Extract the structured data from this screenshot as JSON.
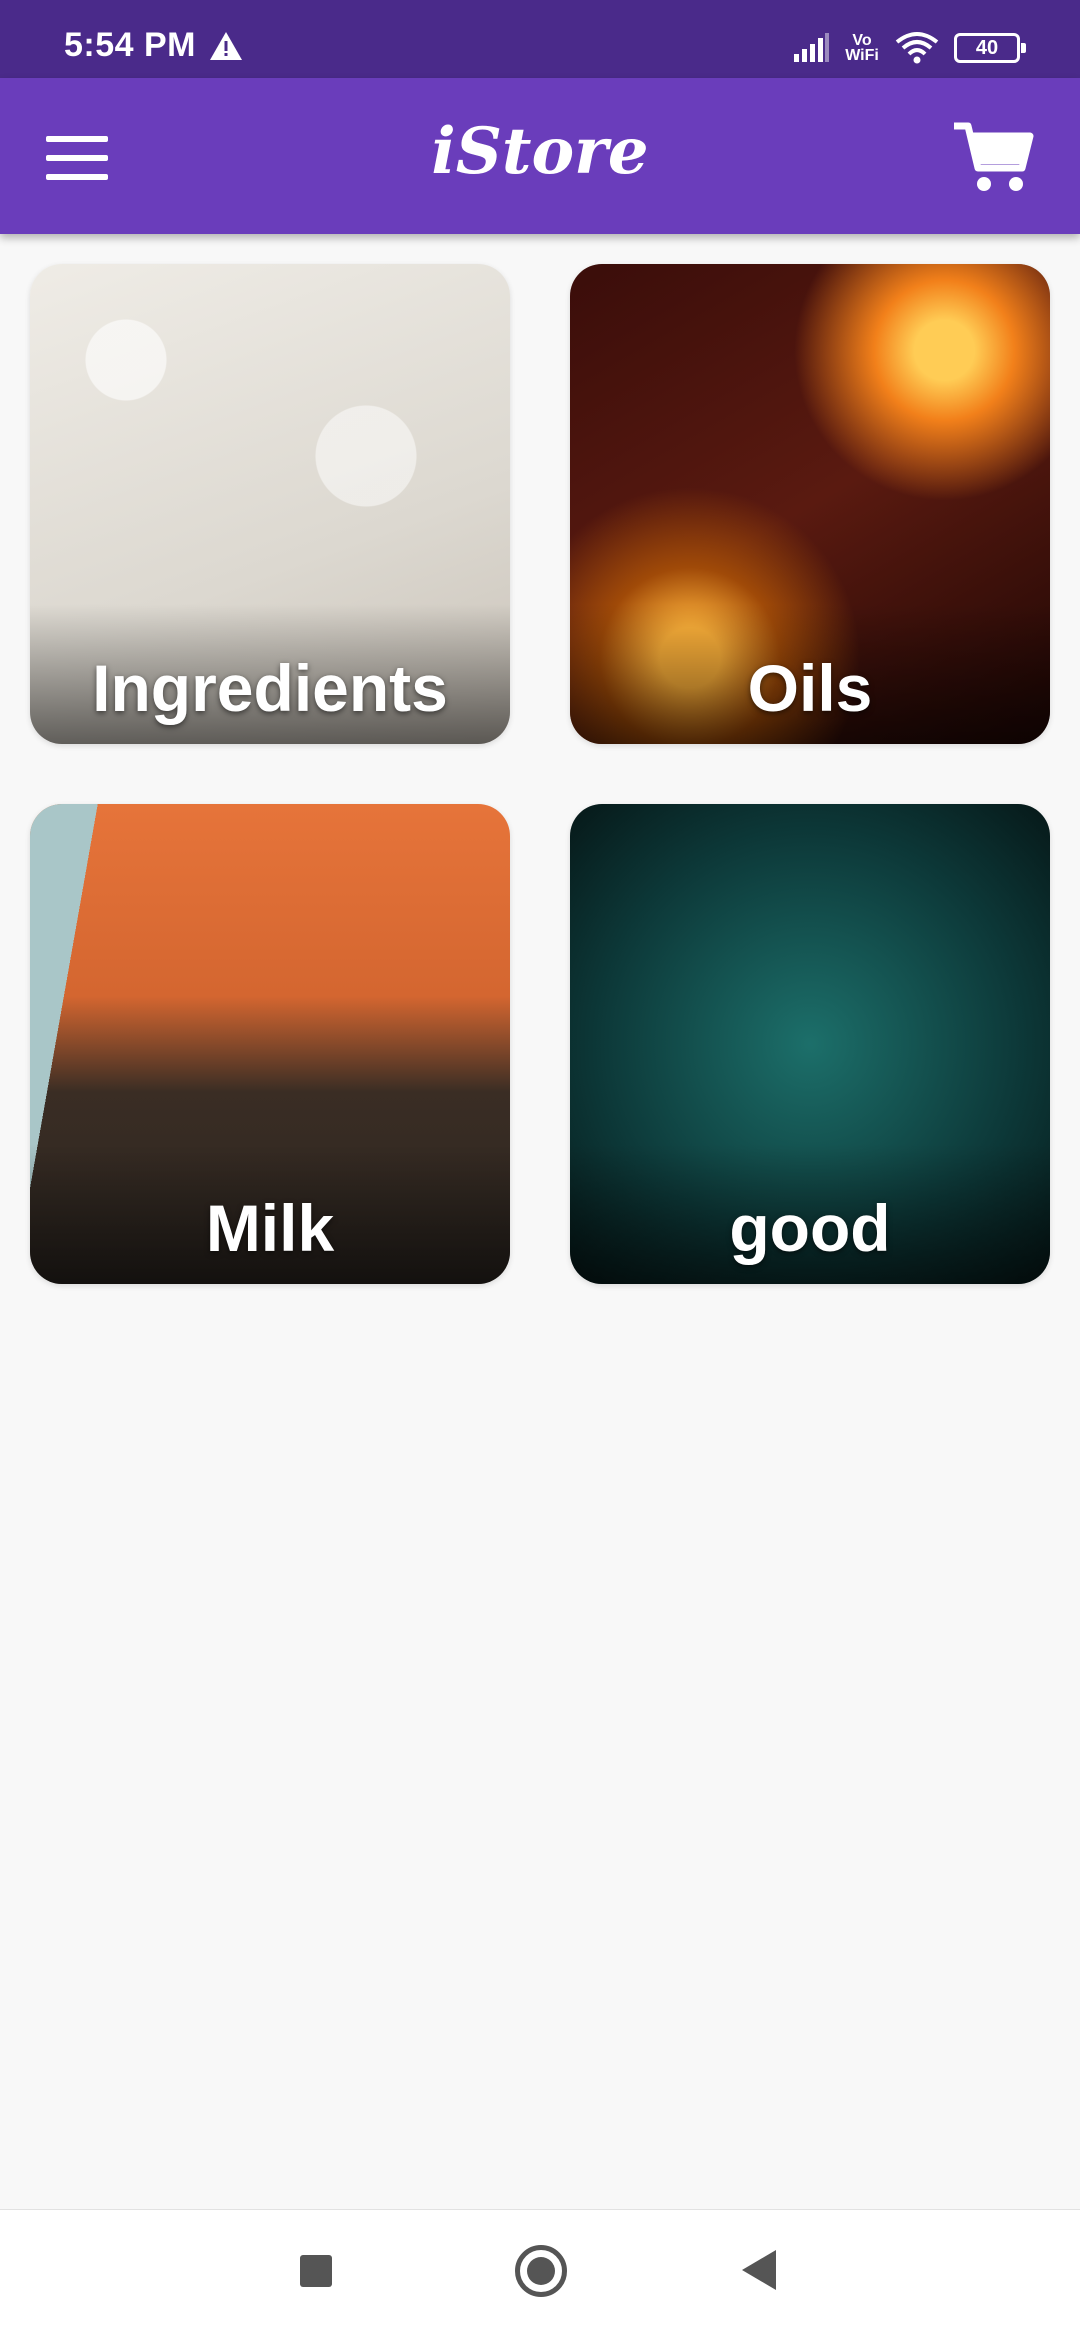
{
  "status_bar": {
    "time": "5:54 PM",
    "warning_icon": "warning-triangle-icon",
    "network_label": "Vo\nWiFi",
    "battery": "40"
  },
  "app_bar": {
    "title": "iStore",
    "menu_icon": "hamburger-menu-icon",
    "cart_icon": "shopping-cart-icon",
    "background": "#6a3dbb"
  },
  "categories": [
    {
      "label": "Ingredients"
    },
    {
      "label": "Oils"
    },
    {
      "label": "Milk"
    },
    {
      "label": "good"
    }
  ],
  "nav_bar": {
    "recents_icon": "square-recents-icon",
    "home_icon": "circle-home-icon",
    "back_icon": "triangle-back-icon"
  }
}
